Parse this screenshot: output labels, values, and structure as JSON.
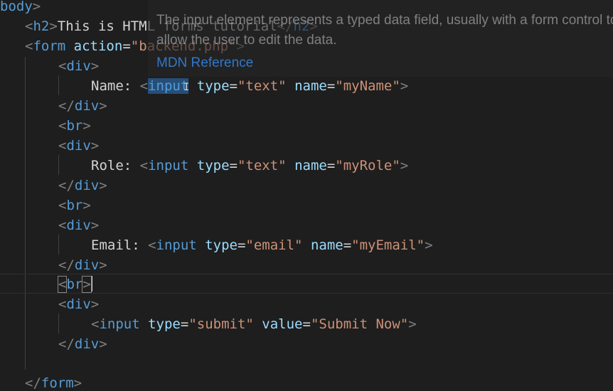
{
  "colors": {
    "background": "#1e1e1e",
    "tag": "#569cd6",
    "attribute": "#9cdcfe",
    "string": "#ce9178",
    "punctuation": "#808080",
    "text": "#d4d4d4",
    "link": "#3794ff"
  },
  "tokens": {
    "lt": "<",
    "gt": ">",
    "close_lt": "</",
    "eq": "=",
    "body": "body",
    "h2": "h2",
    "form": "form",
    "div": "div",
    "br": "br",
    "input": "input",
    "action": "action",
    "type": "type",
    "name": "name",
    "value": "value"
  },
  "code": {
    "h2_text": "This is HTML forms tutorial",
    "form_action": "\"backend.php\"",
    "name_label": "Name: ",
    "name_type": "\"text\"",
    "name_name": "\"myName\"",
    "role_label": "Role: ",
    "role_type": "\"text\"",
    "role_name": "\"myRole\"",
    "email_label": "Email: ",
    "email_type": "\"email\"",
    "email_name": "\"myEmail\"",
    "submit_type": "\"submit\"",
    "submit_value": "\"Submit Now\""
  },
  "hover": {
    "description": "The input element represents a typed data field, usually with a form control to allow the user to edit the data.",
    "link": "MDN Reference"
  }
}
